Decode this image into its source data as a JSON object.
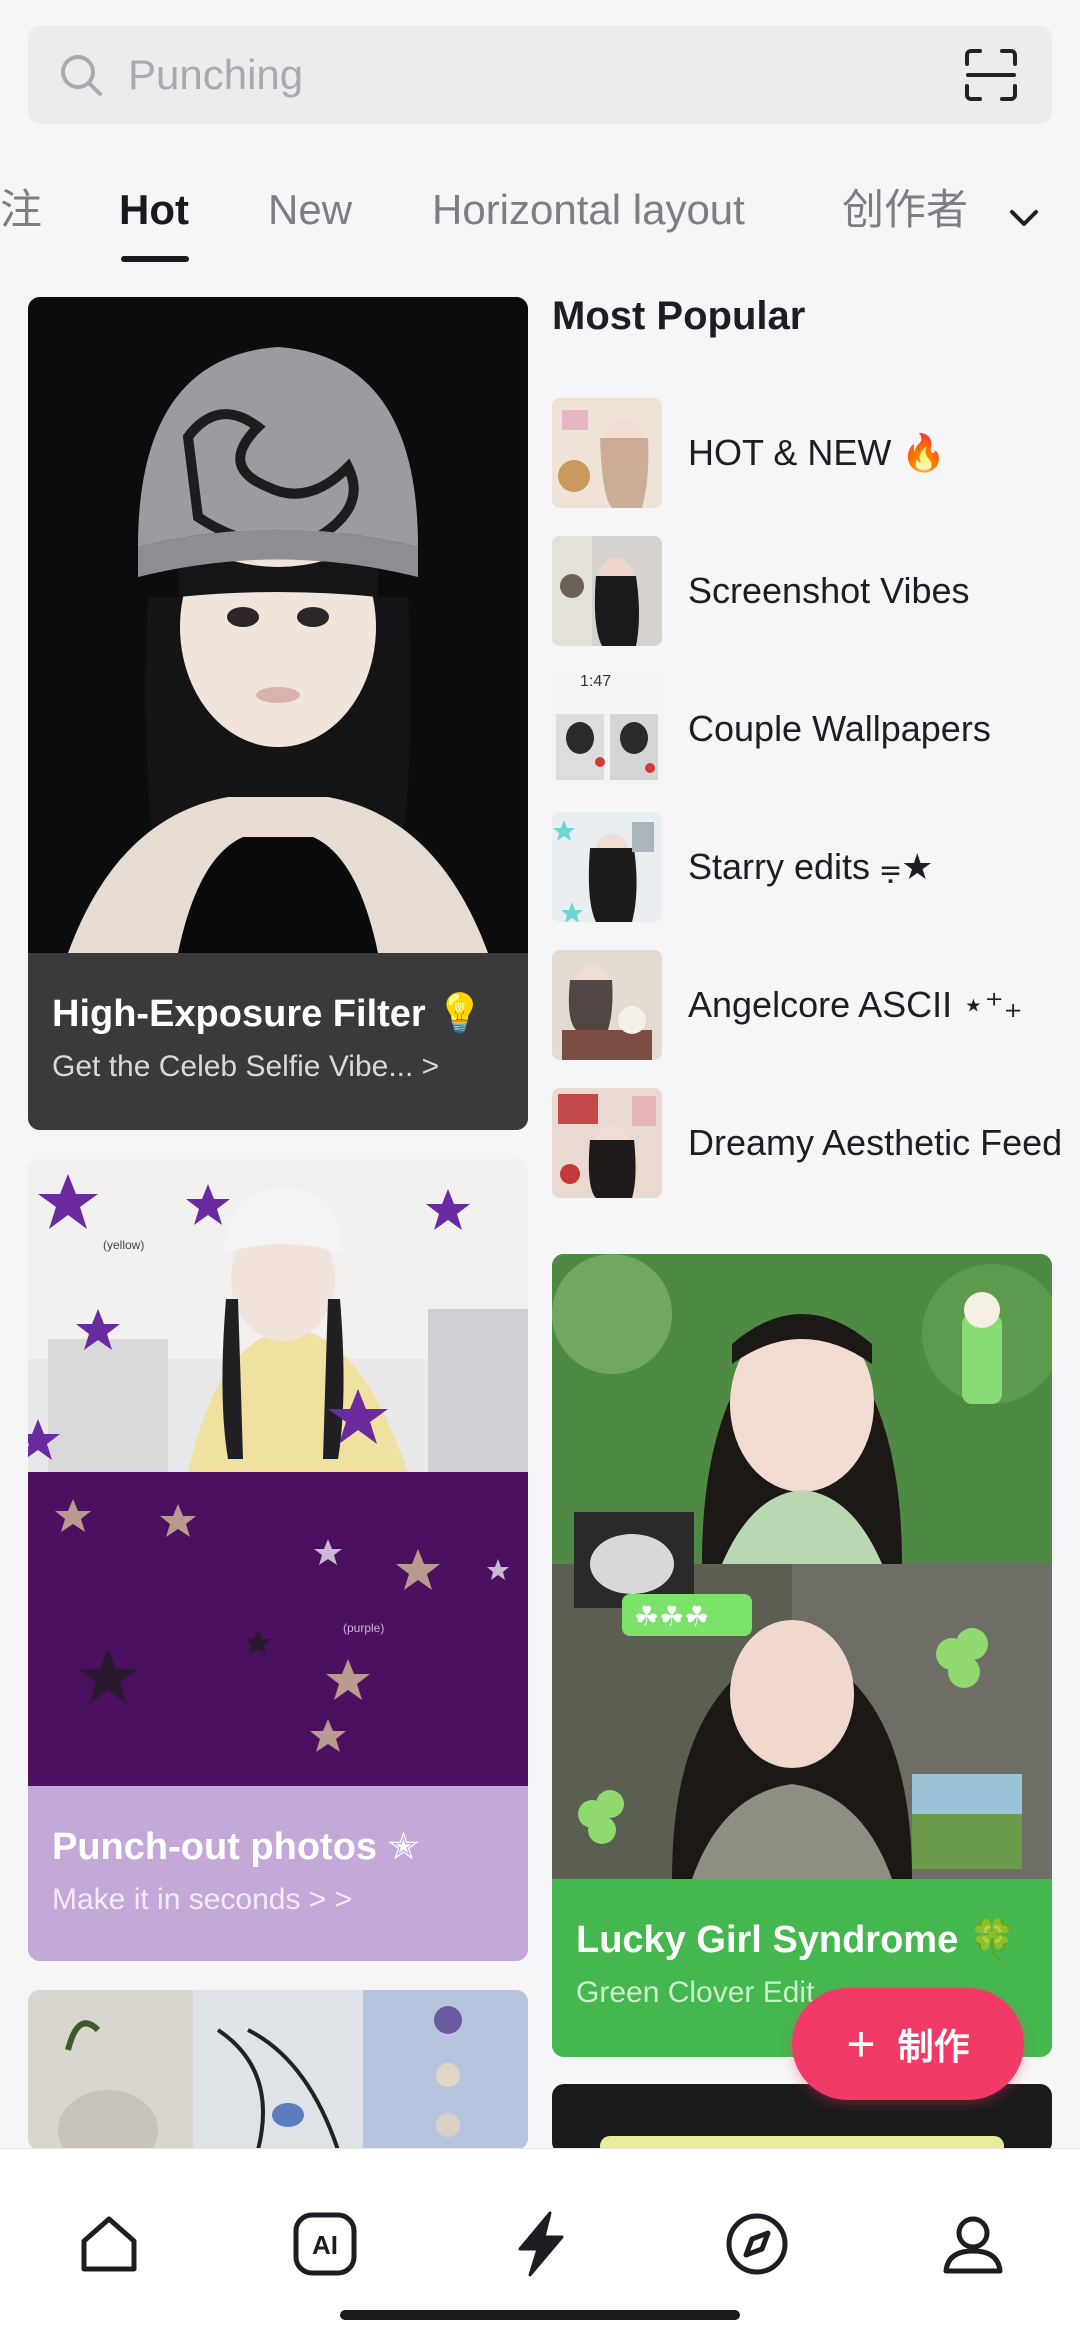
{
  "search": {
    "placeholder": "Punching"
  },
  "tabs": [
    {
      "label": "注"
    },
    {
      "label": "Hot",
      "active": true
    },
    {
      "label": "New"
    },
    {
      "label": "Horizontal layout"
    },
    {
      "label": "创作者"
    }
  ],
  "cards": {
    "exposure": {
      "title": "High-Exposure Filter 💡",
      "subtitle": "Get the Celeb Selfie Vibe... >"
    },
    "punchout": {
      "title": "Punch-out photos ✭",
      "subtitle": "Make it in seconds > >",
      "annotation_top": "(yellow)",
      "annotation_bottom": "(purple)"
    },
    "lucky": {
      "title": "Lucky Girl Syndrome 🍀",
      "subtitle": "Green Clover Edit",
      "badge": "☘☘☘"
    }
  },
  "most_popular": {
    "title": "Most Popular",
    "items": [
      {
        "label": "HOT & NEW 🔥"
      },
      {
        "label": "Screenshot Vibes"
      },
      {
        "label": "Couple Wallpapers"
      },
      {
        "label": "Starry edits ⩦★"
      },
      {
        "label": "Angelcore ASCII ⋆⁺₊"
      },
      {
        "label": "Dreamy Aesthetic Feed"
      }
    ]
  },
  "fab": {
    "label": "制作"
  },
  "nav": {
    "items": [
      {
        "icon": "home-icon"
      },
      {
        "icon": "ai-icon",
        "label": "AI"
      },
      {
        "icon": "lightning-icon"
      },
      {
        "icon": "compass-icon"
      },
      {
        "icon": "profile-icon"
      }
    ]
  },
  "colors": {
    "accent": "#f23a67",
    "green_card": "#44b74f",
    "purple_card": "#c3a8d8",
    "dark_card": "#3a3a3c"
  }
}
